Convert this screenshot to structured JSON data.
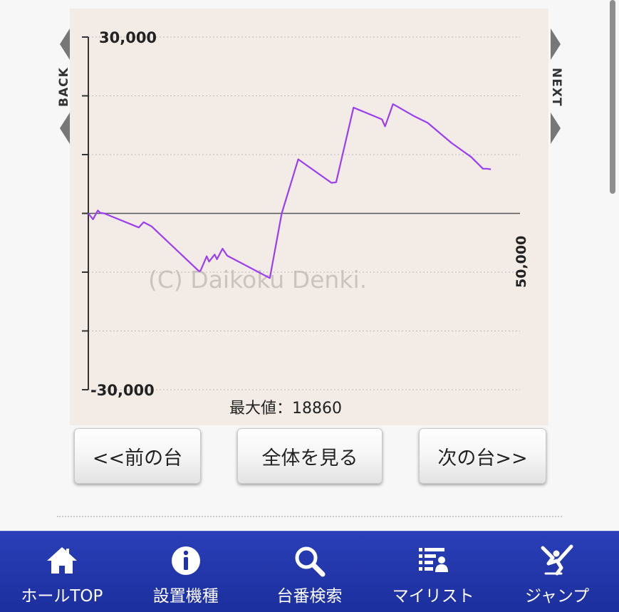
{
  "chart_data": {
    "type": "line",
    "title": "",
    "xlabel": "",
    "ylabel": "",
    "ylim": [
      -30000,
      30000
    ],
    "xlim": [
      0,
      50000
    ],
    "ytick_labels": [
      "30,000",
      "-30,000"
    ],
    "xtick_label": "50,000",
    "grid": true,
    "watermark": "(C) Daikoku Denki.",
    "summary_label": "最大値：18860",
    "color": "#9b3ef0",
    "series": [
      {
        "points": [
          [
            0,
            0
          ],
          [
            600,
            -1000
          ],
          [
            1200,
            500
          ],
          [
            1500,
            100
          ],
          [
            2000,
            0
          ],
          [
            6400,
            -2400
          ],
          [
            7000,
            -1500
          ],
          [
            8000,
            -2200
          ],
          [
            14000,
            -9800
          ],
          [
            14200,
            -9800
          ],
          [
            15000,
            -7300
          ],
          [
            15300,
            -8200
          ],
          [
            16000,
            -7000
          ],
          [
            16300,
            -7800
          ],
          [
            17000,
            -6000
          ],
          [
            17600,
            -7200
          ],
          [
            23000,
            -11000
          ],
          [
            24500,
            0
          ],
          [
            26600,
            9200
          ],
          [
            30800,
            5200
          ],
          [
            31400,
            5300
          ],
          [
            33600,
            18000
          ],
          [
            37200,
            16000
          ],
          [
            37600,
            14800
          ],
          [
            38600,
            18600
          ],
          [
            41200,
            16600
          ],
          [
            43000,
            15400
          ],
          [
            46000,
            12000
          ],
          [
            48500,
            9600
          ],
          [
            50000,
            7600
          ],
          [
            50500,
            7600
          ],
          [
            51000,
            7500
          ]
        ]
      }
    ]
  },
  "nav": {
    "back_label": "BACK",
    "next_label": "NEXT"
  },
  "buttons": {
    "prev": "<<前の台",
    "all": "全体を見る",
    "next": "次の台>>"
  },
  "footer": {
    "items": [
      {
        "label": "ホールTOP",
        "icon": "home-icon"
      },
      {
        "label": "設置機種",
        "icon": "info-icon"
      },
      {
        "label": "台番検索",
        "icon": "search-icon"
      },
      {
        "label": "マイリスト",
        "icon": "mylist-icon"
      },
      {
        "label": "ジャンプ",
        "icon": "jump-icon"
      }
    ]
  }
}
